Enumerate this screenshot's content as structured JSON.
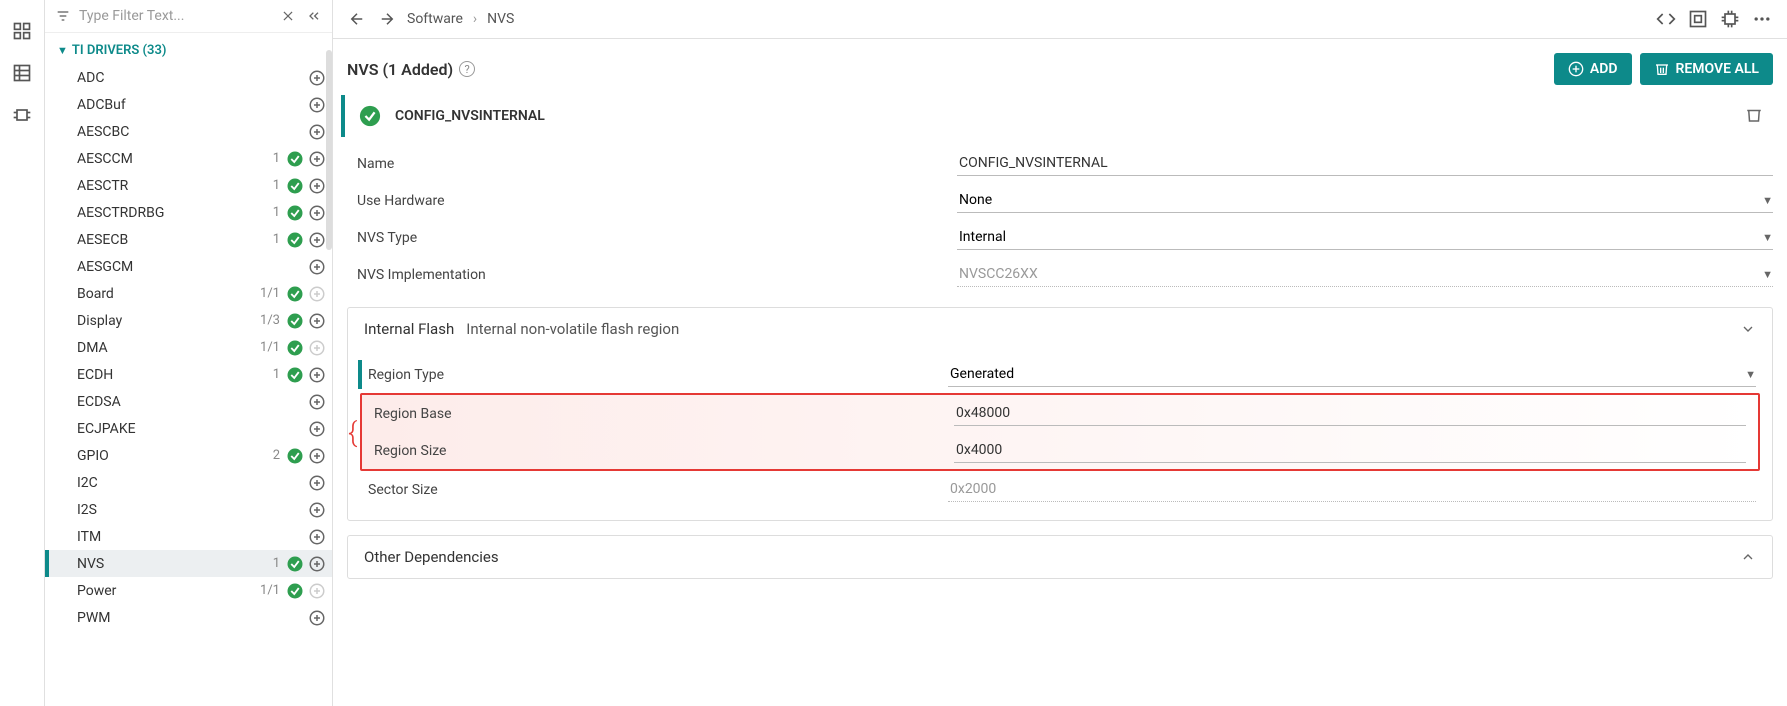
{
  "filter": {
    "placeholder": "Type Filter Text..."
  },
  "tree": {
    "group_label": "TI DRIVERS (33)",
    "items": [
      {
        "label": "ADC",
        "count": "",
        "check": false,
        "add": true
      },
      {
        "label": "ADCBuf",
        "count": "",
        "check": false,
        "add": true
      },
      {
        "label": "AESCBC",
        "count": "",
        "check": false,
        "add": true
      },
      {
        "label": "AESCCM",
        "count": "1",
        "check": true,
        "add": true
      },
      {
        "label": "AESCTR",
        "count": "1",
        "check": true,
        "add": true
      },
      {
        "label": "AESCTRDRBG",
        "count": "1",
        "check": true,
        "add": true
      },
      {
        "label": "AESECB",
        "count": "1",
        "check": true,
        "add": true
      },
      {
        "label": "AESGCM",
        "count": "",
        "check": false,
        "add": true
      },
      {
        "label": "Board",
        "count": "1/1",
        "check": true,
        "add": false
      },
      {
        "label": "Display",
        "count": "1/3",
        "check": true,
        "add": true
      },
      {
        "label": "DMA",
        "count": "1/1",
        "check": true,
        "add": false
      },
      {
        "label": "ECDH",
        "count": "1",
        "check": true,
        "add": true
      },
      {
        "label": "ECDSA",
        "count": "",
        "check": false,
        "add": true
      },
      {
        "label": "ECJPAKE",
        "count": "",
        "check": false,
        "add": true
      },
      {
        "label": "GPIO",
        "count": "2",
        "check": true,
        "add": true
      },
      {
        "label": "I2C",
        "count": "",
        "check": false,
        "add": true
      },
      {
        "label": "I2S",
        "count": "",
        "check": false,
        "add": true
      },
      {
        "label": "ITM",
        "count": "",
        "check": false,
        "add": true
      },
      {
        "label": "NVS",
        "count": "1",
        "check": true,
        "add": true,
        "selected": true
      },
      {
        "label": "Power",
        "count": "1/1",
        "check": true,
        "add": false
      },
      {
        "label": "PWM",
        "count": "",
        "check": false,
        "add": true
      }
    ]
  },
  "breadcrumb": {
    "back": true,
    "fwd": true,
    "crumb1": "Software",
    "crumb2": "NVS"
  },
  "section": {
    "title": "NVS (1 Added)",
    "add_btn": "ADD",
    "remove_btn": "REMOVE ALL"
  },
  "config": {
    "name": "CONFIG_NVSINTERNAL"
  },
  "form": {
    "name_label": "Name",
    "name_value": "CONFIG_NVSINTERNAL",
    "hw_label": "Use Hardware",
    "hw_value": "None",
    "type_label": "NVS Type",
    "type_value": "Internal",
    "impl_label": "NVS Implementation",
    "impl_value": "NVSCC26XX"
  },
  "flash": {
    "title": "Internal Flash",
    "subtitle": "Internal non-volatile flash region",
    "region_type_label": "Region Type",
    "region_type_value": "Generated",
    "region_base_label": "Region Base",
    "region_base_value": "0x48000",
    "region_size_label": "Region Size",
    "region_size_value": "0x4000",
    "sector_size_label": "Sector Size",
    "sector_size_value": "0x2000"
  },
  "deps": {
    "title": "Other Dependencies"
  }
}
